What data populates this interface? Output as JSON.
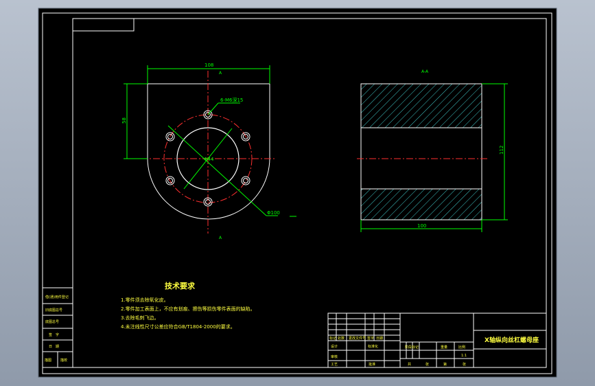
{
  "drawing": {
    "title": "X轴纵向丝杠螺母座",
    "scale": "1:1",
    "technical_requirements": {
      "heading": "技术要求",
      "items": [
        "1.零件须去除氧化皮。",
        "2.零件加工表面上，不应有划痕、擦伤等损伤零件表面的缺陷。",
        "3.去除毛刺飞边。",
        "4.未注线性尺寸公差应符合GB/T1804-2000的要求。"
      ]
    },
    "front_view": {
      "dim_width": "108",
      "dim_height": "58",
      "hole_callout": "6-M6深15",
      "center_dia": "Φ44",
      "outer_dia": "Φ100",
      "section_mark_top": "A",
      "section_mark_bottom": "A"
    },
    "section_view": {
      "label": "A-A",
      "dim_height": "112",
      "dim_width": "100"
    },
    "left_table": {
      "rows": [
        "借(通)用件登记",
        "旧底图总号",
        "底图总号",
        "签　字",
        "日　期"
      ],
      "footer": [
        "描图",
        "描校"
      ]
    },
    "title_block": {
      "row_labels": [
        "标记",
        "处数",
        "更改文件号",
        "签字",
        "日期"
      ],
      "design_label": "设计",
      "standard_label": "标准化",
      "review_label": "审核",
      "process_label": "工艺",
      "approve_label": "批准",
      "stage_labels": [
        "阶段标记",
        "重量",
        "比例"
      ],
      "sheet_labels": [
        "共",
        "张",
        "第",
        "张"
      ]
    }
  },
  "colors": {
    "background": "#000000",
    "frame": "#ffffff",
    "dimension": "#00ff00",
    "centerline": "#ff3030",
    "hatch": "#40c8c8",
    "text_yellow": "#ffff40"
  }
}
